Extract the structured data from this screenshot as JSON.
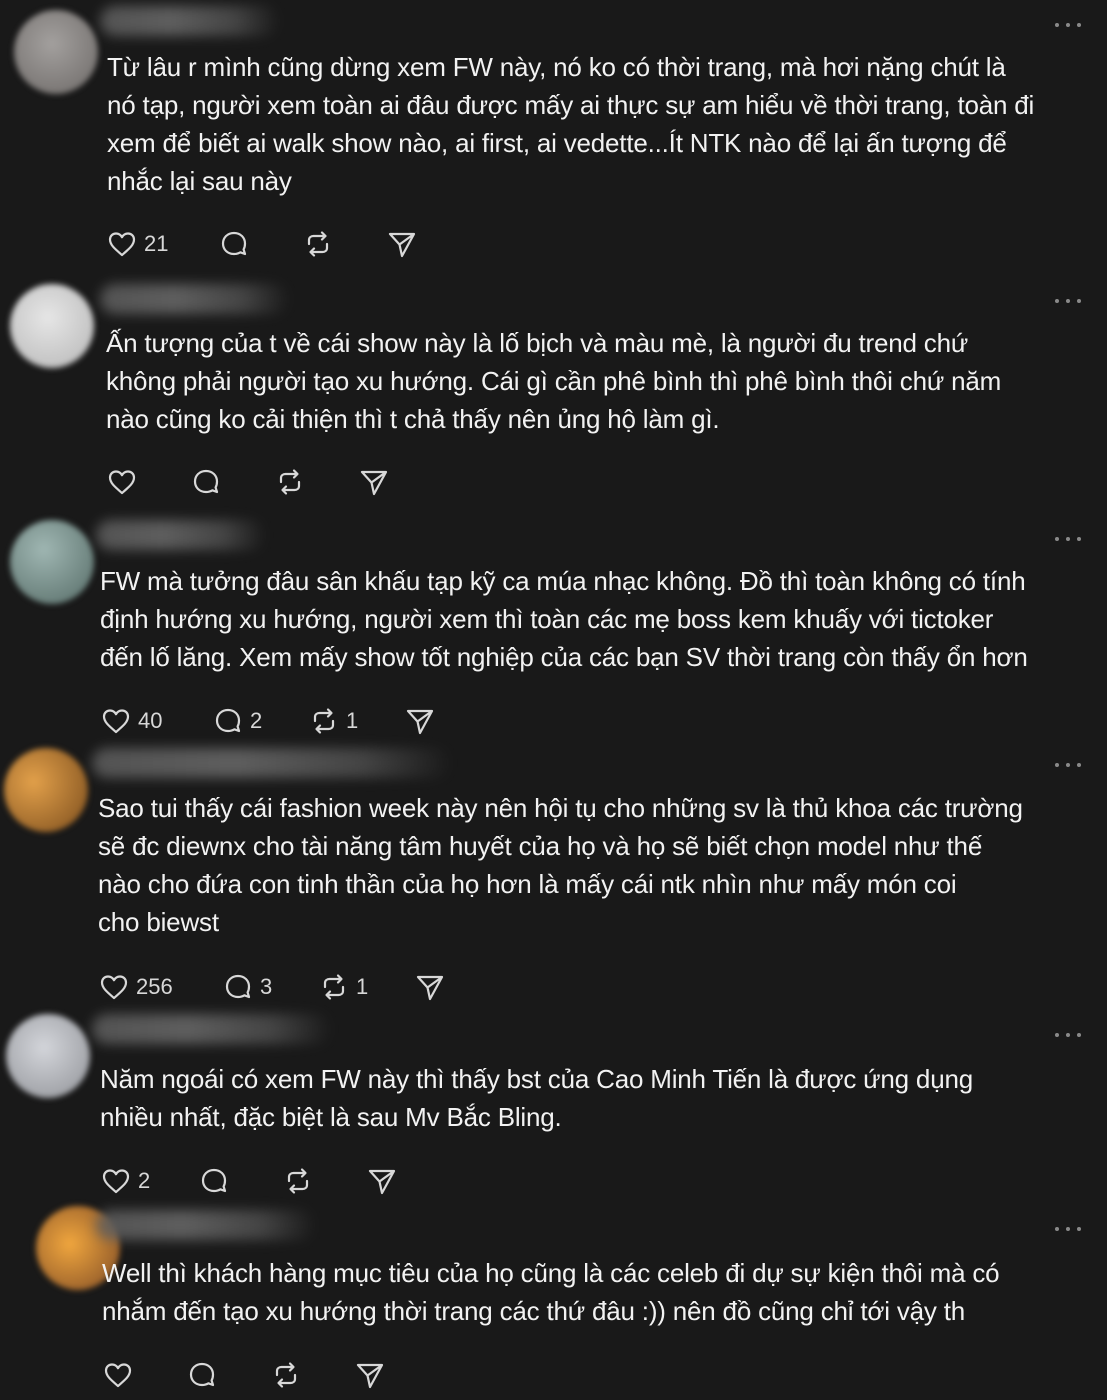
{
  "comments": [
    {
      "avatar_color": "#8a8684",
      "lines": [
        "Từ lâu r mình cũng dừng xem FW này, nó ko có thời trang, mà hơi nặng chút là",
        "nó tạp, người xem toàn ai đâu được mấy ai thực sự am hiểu về thời trang, toàn đi",
        "xem để biết ai walk show nào, ai first, ai vedette...Ít NTK nào để lại ấn tượng để",
        "nhắc lại sau này"
      ],
      "likes": "21",
      "replies": "",
      "reposts": ""
    },
    {
      "avatar_color": "#cfcfcf",
      "lines": [
        "Ấn tượng của t về cái show này là lố bịch và màu mè, là người đu trend chứ",
        "không phải người tạo xu hướng. Cái gì cần phê bình thì phê bình thôi chứ năm",
        "nào cũng ko cải thiện thì t chả thấy nên ủng hộ làm gì."
      ],
      "likes": "",
      "replies": "",
      "reposts": ""
    },
    {
      "avatar_color": "#6f8a86",
      "lines": [
        "FW mà tưởng đâu sân khấu tạp kỹ ca múa nhạc không. Đồ thì toàn không có tính",
        "định hướng xu hướng, người xem thì toàn các mẹ boss kem khuấy với tictoker",
        "đến lố lăng. Xem mấy show tốt nghiệp của các bạn SV thời trang còn thấy ổn hơn"
      ],
      "likes": "40",
      "replies": "2",
      "reposts": "1"
    },
    {
      "avatar_color": "#c88a3c",
      "lines": [
        "Sao tui thấy cái fashion week này nên hội tụ cho những sv là thủ khoa các trường",
        "sẽ đc diewnx cho tài năng tâm huyết của họ và họ sẽ biết chọn model như thế",
        "nào cho đứa con tinh thần của họ hơn là mấy cái ntk nhìn như mấy món coi",
        "cho biewst"
      ],
      "likes": "256",
      "replies": "3",
      "reposts": "1"
    },
    {
      "avatar_color": "#b9bcc2",
      "lines": [
        "Năm ngoái có xem FW này thì thấy bst của Cao Minh Tiến là được ứng dụng",
        "nhiều nhất, đặc biệt là sau Mv Bắc Bling."
      ],
      "likes": "2",
      "replies": "",
      "reposts": ""
    },
    {
      "avatar_color": "#d98a3a",
      "lines": [
        "Well thì khách hàng mục tiêu của họ cũng là các celeb đi dự sự kiện thôi mà có",
        "nhắm đến tạo xu hướng thời trang các thứ đâu :)) nên đồ cũng chỉ tới vậy th"
      ],
      "likes": "",
      "replies": "",
      "reposts": ""
    }
  ]
}
